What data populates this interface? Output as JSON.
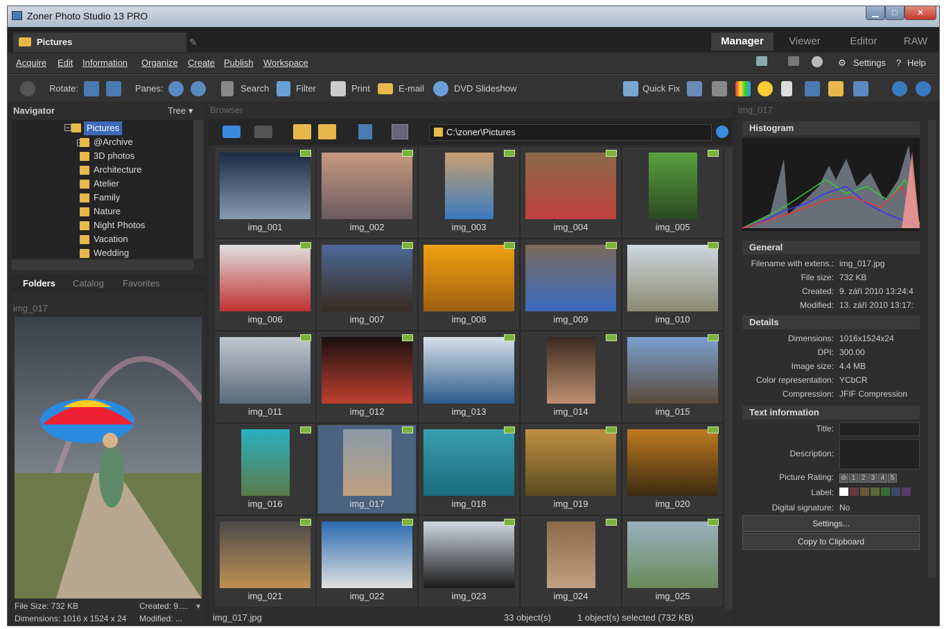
{
  "window": {
    "title": "Zoner Photo Studio 13 PRO",
    "min": "▁",
    "max": "□",
    "close": "✕"
  },
  "location": {
    "tab": "Pictures"
  },
  "modes": {
    "manager": "Manager",
    "viewer": "Viewer",
    "editor": "Editor",
    "raw": "RAW"
  },
  "menu": {
    "acquire": "Acquire",
    "edit": "Edit",
    "information": "Information",
    "organize": "Organize",
    "create": "Create",
    "publish": "Publish",
    "workspace": "Workspace",
    "settings": "Settings",
    "help": "Help"
  },
  "toolbar": {
    "rotate": "Rotate:",
    "panes": "Panes:",
    "search": "Search",
    "filter": "Filter",
    "print": "Print",
    "email": "E-mail",
    "dvd": "DVD Slideshow",
    "quickfix": "Quick Fix"
  },
  "navigator": {
    "title": "Navigator",
    "mode": "Tree",
    "root": "Pictures",
    "folders": [
      "@Archive",
      "3D photos",
      "Architecture",
      "Atelier",
      "Family",
      "Nature",
      "Night Photos",
      "Vacation",
      "Wedding"
    ],
    "tabs": [
      "Folders",
      "Catalog",
      "Favorites"
    ]
  },
  "preview": {
    "title": "img_017",
    "file_size": "File Size: 732 KB",
    "created": "Created: 9....",
    "dimensions": "Dimensions: 1016 x 1524 x 24",
    "modified": "Modified: ..."
  },
  "browser": {
    "title": "Browser",
    "path": "C:\\zoner\\Pictures",
    "items": [
      "img_001",
      "img_002",
      "img_003",
      "img_004",
      "img_005",
      "img_006",
      "img_007",
      "img_008",
      "img_009",
      "img_010",
      "img_011",
      "img_012",
      "img_013",
      "img_014",
      "img_015",
      "img_016",
      "img_017",
      "img_018",
      "img_019",
      "img_020",
      "img_021",
      "img_022",
      "img_023",
      "img_024",
      "img_025"
    ],
    "status_file": "img_017.jpg",
    "status_count": "33 object(s)",
    "status_selected": "1 object(s) selected (732 KB)"
  },
  "props": {
    "title": "img_017",
    "histogram": "Histogram",
    "general": "General",
    "filename_k": "Filename with extens.:",
    "filename_v": "img_017.jpg",
    "filesize_k": "File size:",
    "filesize_v": "732 KB",
    "created_k": "Created:",
    "created_v": "9. září 2010 13:24:4",
    "modified_k": "Modified:",
    "modified_v": "13. září 2010 13:17:",
    "details": "Details",
    "dim_k": "Dimensions:",
    "dim_v": "1016x1524x24",
    "dpi_k": "DPI:",
    "dpi_v": "300.00",
    "isize_k": "Image size:",
    "isize_v": "4.4 MB",
    "color_k": "Color representation:",
    "color_v": "YCbCR",
    "comp_k": "Compression:",
    "comp_v": "JFIF Compression",
    "textinfo": "Text information",
    "title_k": "Title:",
    "desc_k": "Description:",
    "rating_k": "Picture Rating:",
    "rating_values": [
      "1",
      "2",
      "3",
      "4",
      "5"
    ],
    "label_k": "Label:",
    "sig_k": "Digital signature:",
    "sig_v": "No",
    "settings_btn": "Settings...",
    "copy_btn": "Copy to Clipboard"
  },
  "colors": {
    "accent": "#3d69b8",
    "selected": "#4b6280",
    "folder": "#e8b84a",
    "badge": "#7ab23a"
  }
}
